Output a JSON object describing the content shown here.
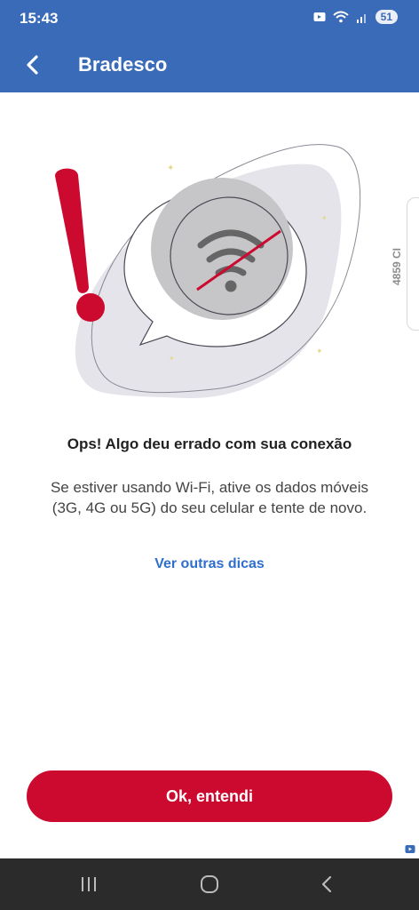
{
  "status_bar": {
    "time": "15:43",
    "battery": "51",
    "icons": [
      "notification-icon",
      "wifi-icon",
      "signal-icon"
    ]
  },
  "app_bar": {
    "title": "Bradesco",
    "back_icon": "chevron-left-icon"
  },
  "side_tab": {
    "label": "4859 CI"
  },
  "error": {
    "title": "Ops! Algo deu errado com sua conexão",
    "message": "Se estiver usando Wi-Fi, ative os dados móveis (3G, 4G ou 5G) do seu celular e tente de novo.",
    "link": "Ver outras dicas"
  },
  "actions": {
    "ok_label": "Ok, entendi"
  },
  "nav": {
    "recents_icon": "recents-icon",
    "home_icon": "home-icon",
    "back_icon": "back-icon"
  },
  "colors": {
    "header": "#3a6bb8",
    "accent_red": "#cc092f",
    "link_blue": "#2f6fcb"
  }
}
